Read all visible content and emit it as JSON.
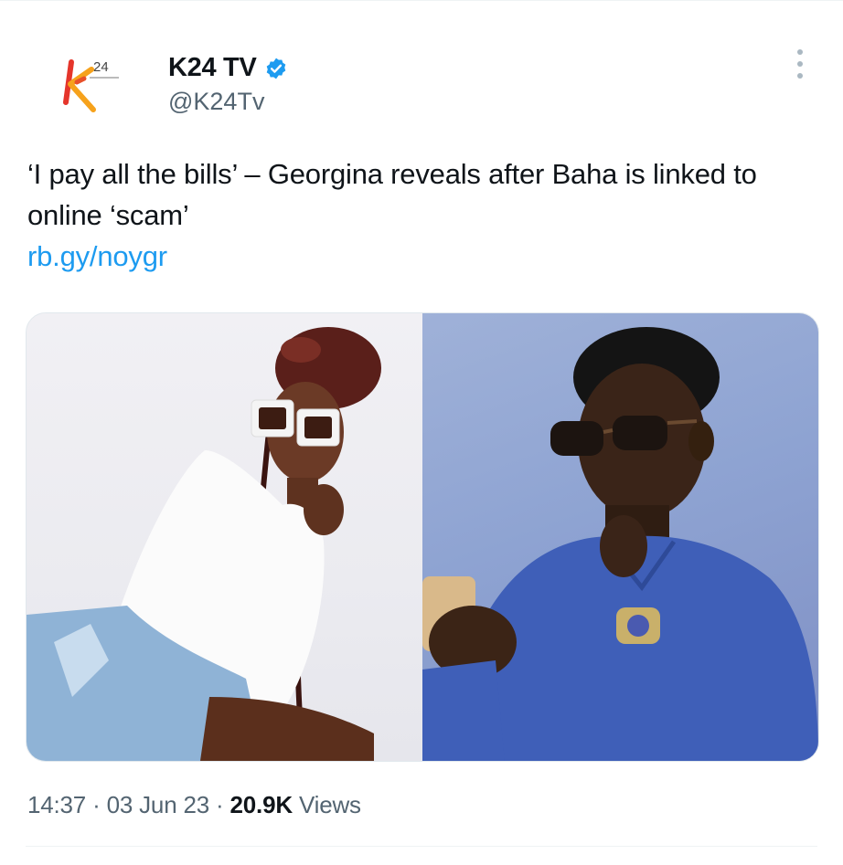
{
  "tweet": {
    "author": {
      "name": "K24 TV",
      "handle": "@K24Tv",
      "verified": true,
      "avatar_icon": "k24-logo",
      "logo_text": "24"
    },
    "text": "‘I pay all the bills’ – Georgina reveals after Baha is linked to online ‘scam’",
    "link": "rb.gy/noygr",
    "media": {
      "left_photo": "woman-white-sunglasses-photo",
      "right_photo": "man-sunglasses-phone-photo"
    },
    "time": "14:37",
    "sep1": " · ",
    "date": "03 Jun 23",
    "sep2": " · ",
    "views_count": "20.9K",
    "views_label": " Views"
  },
  "colors": {
    "link": "#1d9bf0",
    "verified": "#1d9bf0",
    "secondary_text": "#536471",
    "primary_text": "#0f1419"
  }
}
